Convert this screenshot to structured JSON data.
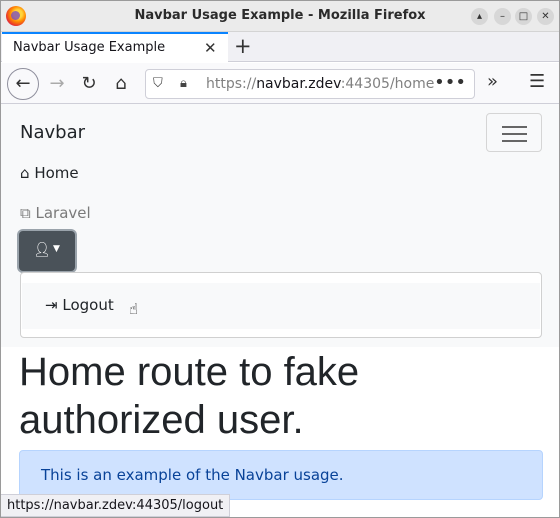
{
  "window": {
    "title": "Navbar Usage Example - Mozilla Firefox"
  },
  "tabs": [
    {
      "label": "Navbar Usage Example"
    }
  ],
  "toolbar": {
    "url_host_prefix": "https://",
    "url_host": "navbar.zdev",
    "url_rest": ":44305/home"
  },
  "site": {
    "brand": "Navbar",
    "nav": {
      "home": "Home",
      "laravel": "Laravel"
    },
    "dropdown": {
      "logout": "Logout"
    }
  },
  "main": {
    "heading": "Home route to fake authorized user.",
    "alert": "This is an example of the Navbar usage."
  },
  "status": {
    "url": "https://navbar.zdev:44305/logout"
  },
  "colors": {
    "accent": "#0a84ff",
    "user_button": "#4a5259",
    "alert_bg": "#cfe2ff",
    "alert_text": "#084298"
  },
  "icons": [
    "firefox-logo",
    "back-icon",
    "forward-icon",
    "reload-icon",
    "home-icon",
    "shield-icon",
    "lock-icon",
    "more-icon",
    "overflow-icon",
    "menu-icon",
    "user-icon",
    "external-link-icon",
    "sign-out-icon"
  ]
}
